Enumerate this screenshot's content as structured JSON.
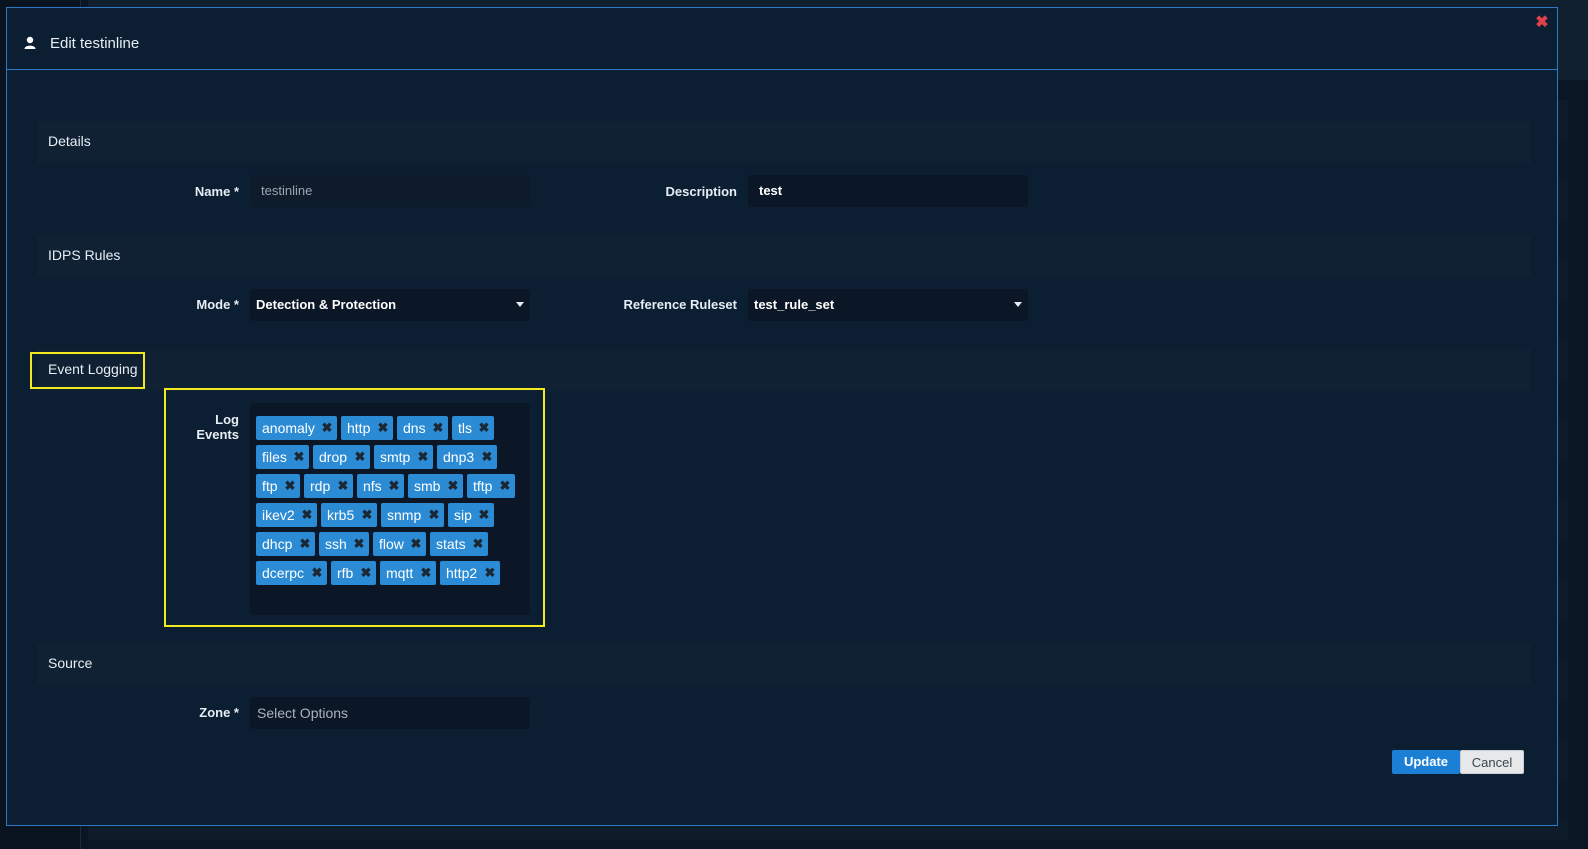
{
  "modal": {
    "title": "Edit testinline",
    "user_icon": "user-icon",
    "close_icon": "close-icon"
  },
  "details": {
    "section_title": "Details",
    "name_label": "Name *",
    "name_value": "testinline",
    "description_label": "Description",
    "description_value": "test"
  },
  "idps_rules": {
    "section_title": "IDPS Rules",
    "mode_label": "Mode *",
    "mode_value": "Detection & Protection",
    "ruleset_label": "Reference Ruleset",
    "ruleset_value": "test_rule_set"
  },
  "event_logging": {
    "section_title": "Event Logging",
    "log_events_label": "Log Events",
    "tags": [
      "anomaly",
      "http",
      "dns",
      "tls",
      "files",
      "drop",
      "smtp",
      "dnp3",
      "ftp",
      "rdp",
      "nfs",
      "smb",
      "tftp",
      "ikev2",
      "krb5",
      "snmp",
      "sip",
      "dhcp",
      "ssh",
      "flow",
      "stats",
      "dcerpc",
      "rfb",
      "mqtt",
      "http2"
    ]
  },
  "source": {
    "section_title": "Source",
    "zone_label": "Zone *",
    "zone_placeholder": "Select Options"
  },
  "footer": {
    "update_label": "Update",
    "cancel_label": "Cancel"
  },
  "colors": {
    "accent": "#2f79c2",
    "tag": "#2b8bd4",
    "highlight": "#f2ea1e",
    "primary_button": "#1b7fd6"
  }
}
